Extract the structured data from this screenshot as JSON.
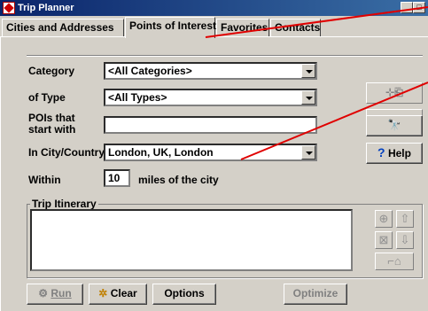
{
  "window": {
    "title": "Trip Planner"
  },
  "tabs": [
    {
      "label": "Cities and Addresses",
      "active": false
    },
    {
      "label": "Points of Interest",
      "active": true
    },
    {
      "label": "Favorites",
      "active": false
    },
    {
      "label": "Contacts",
      "active": false
    }
  ],
  "form": {
    "category": {
      "label": "Category",
      "value": "<All Categories>"
    },
    "type": {
      "label": "of Type",
      "value": "<All Types>"
    },
    "starts_with": {
      "label_line1": "POIs that",
      "label_line2": "start with",
      "value": ""
    },
    "city": {
      "label": "In City/Country",
      "value": "London, UK, London"
    },
    "within": {
      "label": "Within",
      "value": "10",
      "suffix": "miles of the city"
    }
  },
  "side_buttons": {
    "help_label": "Help"
  },
  "itinerary": {
    "label": "Trip Itinerary"
  },
  "bottom_buttons": {
    "run_label": "Run",
    "clear_label": "Clear",
    "options_label": "Options",
    "optimize_label": "Optimize"
  },
  "colors": {
    "titlebar": "#0a246a",
    "annotation": "#e00000",
    "face": "#d4d0c8"
  }
}
